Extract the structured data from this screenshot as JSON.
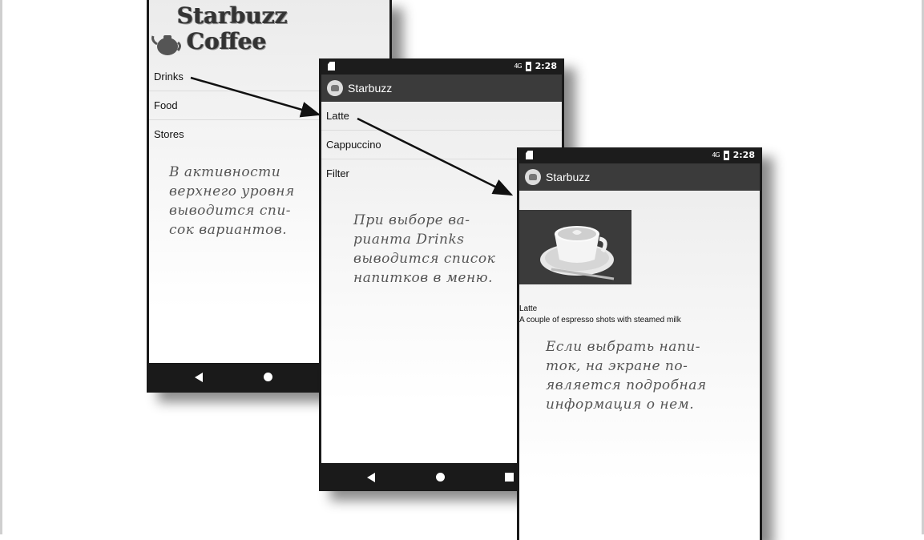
{
  "status": {
    "time": "2:28",
    "network": "4G"
  },
  "app_title": "Starbuzz",
  "logo": {
    "line1": "Starbuzz",
    "line2": "Coffee"
  },
  "top_level_options": [
    "Drinks",
    "Food",
    "Stores"
  ],
  "drinks": [
    "Latte",
    "Cappuccino",
    "Filter"
  ],
  "detail": {
    "name": "Latte",
    "description": "A couple of espresso shots with steamed milk"
  },
  "notes": {
    "phone1": "В активности\nверхнего уровня\nвыводится спи-\nсок вариантов.",
    "phone2": "При выборе ва-\nрианта Drinks\nвыводится список\nнапитков в меню.",
    "phone3": "Если выбрать напи-\nток, на экране по-\nявляется подробная\nинформация о нем."
  },
  "colors": {
    "app_bar": "#3b3b3b",
    "status_bar": "#1c1c1c",
    "phone_frame": "#1a1a1a"
  }
}
